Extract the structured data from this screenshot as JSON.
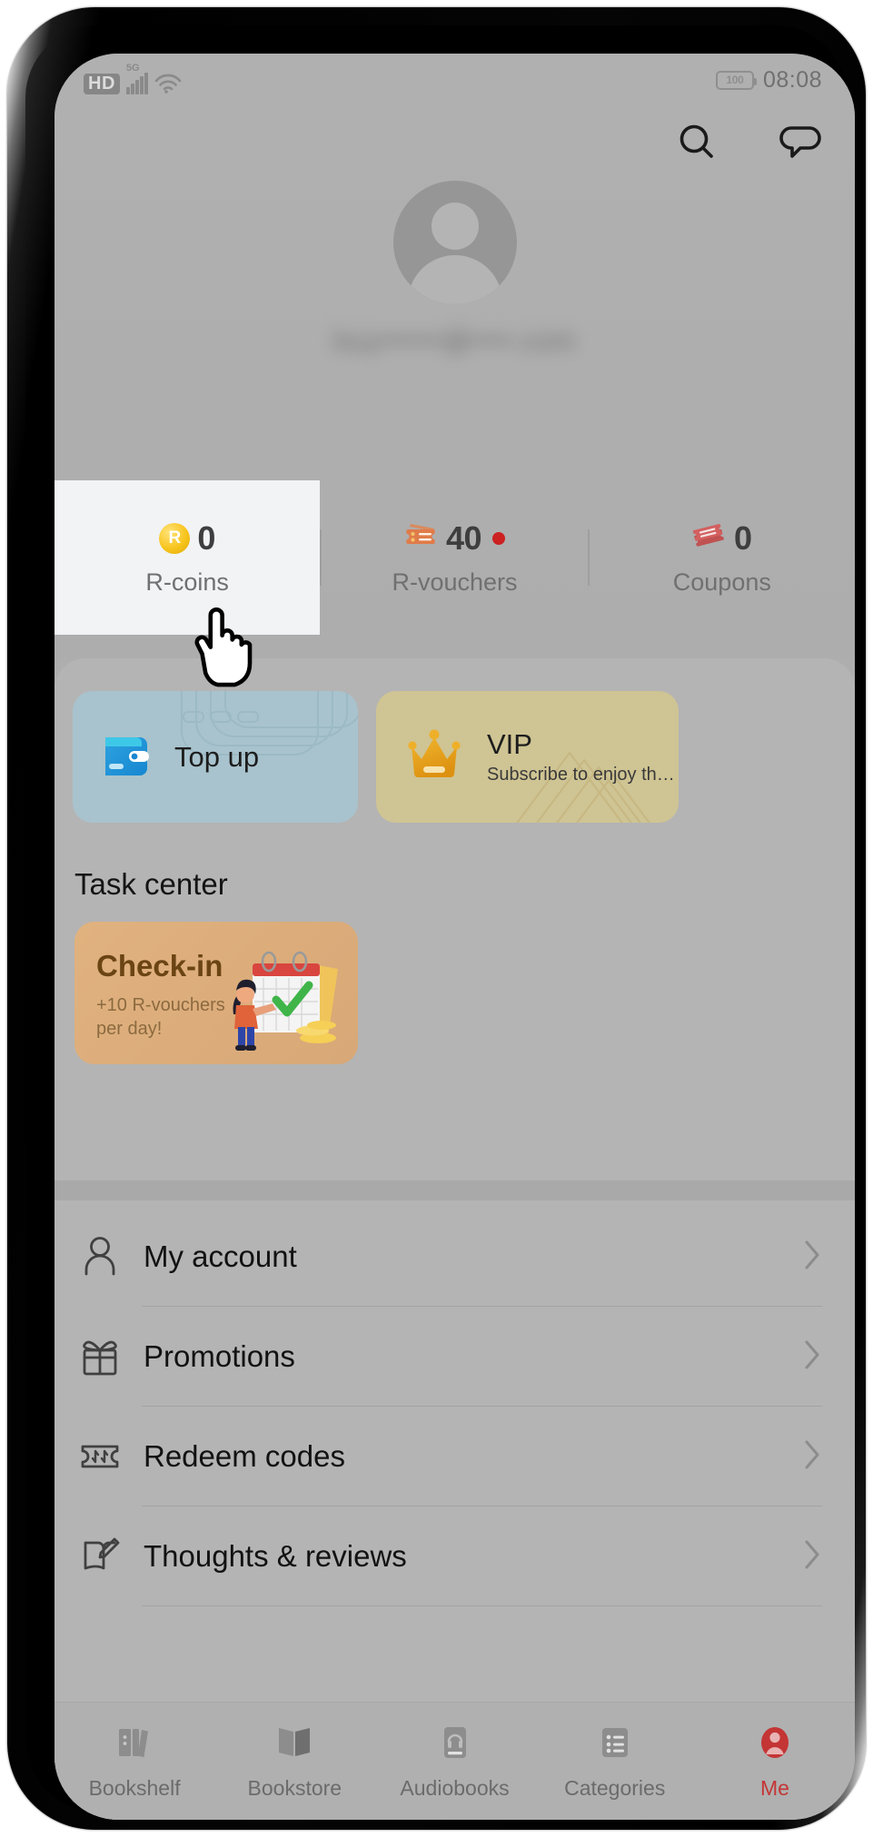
{
  "status_bar": {
    "hd_label": "HD",
    "network": "5G",
    "wifi_icon": "wifi-icon",
    "battery_level": "100",
    "time": "08:08"
  },
  "header": {
    "search_icon": "search-icon",
    "message_icon": "message-bubble-icon"
  },
  "profile": {
    "avatar_icon": "default-avatar-icon",
    "email": "buy••••••@••••.com"
  },
  "stats": [
    {
      "icon": "r-coin-icon",
      "icon_letter": "R",
      "value": "0",
      "label": "R-coins",
      "badge": false,
      "active": true
    },
    {
      "icon": "r-voucher-ticket-icon",
      "value": "40",
      "label": "R-vouchers",
      "badge": true,
      "active": false
    },
    {
      "icon": "coupon-icon",
      "value": "0",
      "label": "Coupons",
      "badge": false,
      "active": false
    }
  ],
  "promos": [
    {
      "id": "topup",
      "icon": "wallet-icon",
      "title": "Top up",
      "subtitle": ""
    },
    {
      "id": "vip",
      "icon": "crown-icon",
      "title": "VIP",
      "subtitle": "Subscribe to enjoy th…"
    }
  ],
  "task_center": {
    "title": "Task center",
    "card": {
      "title": "Check-in",
      "subtitle": "+10 R-vouchers per day!",
      "illustration": "calendar-checkin-illustration"
    }
  },
  "menu": [
    {
      "icon": "person-outline-icon",
      "label": "My account",
      "chevron": "chevron-right-icon"
    },
    {
      "icon": "gift-icon",
      "label": "Promotions",
      "chevron": "chevron-right-icon"
    },
    {
      "icon": "redeem-ticket-icon",
      "label": "Redeem codes",
      "chevron": "chevron-right-icon"
    },
    {
      "icon": "book-edit-icon",
      "label": "Thoughts & reviews",
      "chevron": "chevron-right-icon"
    }
  ],
  "bottom_nav": [
    {
      "icon": "bookshelf-icon",
      "label": "Bookshelf",
      "active": false
    },
    {
      "icon": "bookstore-icon",
      "label": "Bookstore",
      "active": false
    },
    {
      "icon": "audiobooks-icon",
      "label": "Audiobooks",
      "active": false
    },
    {
      "icon": "categories-icon",
      "label": "Categories",
      "active": false
    },
    {
      "icon": "me-avatar-icon",
      "label": "Me",
      "active": true
    }
  ],
  "cursor": {
    "icon": "pointing-hand-cursor"
  },
  "colors": {
    "accent": "#c43535",
    "coin": "#f8c51e",
    "voucher": "#e07b4a",
    "coupon": "#cc5555",
    "badge": "#cc2121",
    "topup_bg": "#a8c3cd",
    "vip_bg": "#cfc493",
    "checkin_bg": "#e0b27f",
    "screen_bg": "#b0b0b0"
  }
}
